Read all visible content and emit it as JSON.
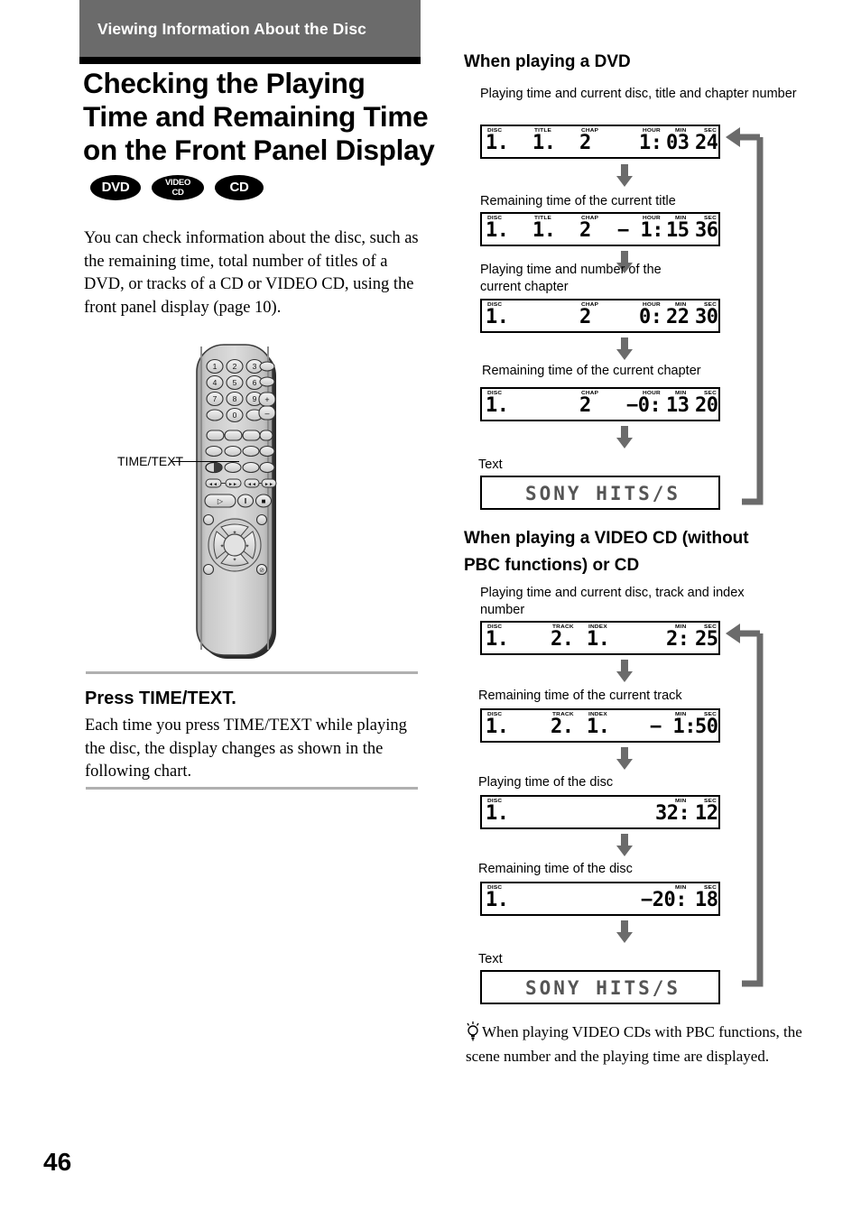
{
  "header": {
    "band_title": "Viewing Information About the Disc",
    "page_title": "Checking the Playing Time and Remaining Time on the Front Panel Display",
    "badges": [
      {
        "name": "dvd-badge",
        "label": "DVD"
      },
      {
        "name": "video-cd-badge",
        "line1": "VIDEO",
        "line2": "CD"
      },
      {
        "name": "cd-badge",
        "label": "CD"
      }
    ]
  },
  "intro": {
    "paragraph": "You can check information about the disc, such as the remaining time, total number of titles of a DVD, or tracks of a CD or VIDEO CD, using the front panel display (page 10)."
  },
  "remote": {
    "callout_label": "TIME/TEXT",
    "keypad": [
      "1",
      "2",
      "3",
      "4",
      "5",
      "6",
      "7",
      "8",
      "9",
      "0"
    ],
    "volume_plus": "+",
    "volume_minus": "−"
  },
  "press_section": {
    "heading": "Press TIME/TEXT.",
    "body": "Each time you press TIME/TEXT while playing the disc, the display changes as shown in the following chart."
  },
  "page_number": "46",
  "dvd_section": {
    "heading": "When playing a DVD",
    "steps": [
      {
        "caption": "Playing time and current disc, title and chapter number",
        "labels": [
          "DISC",
          "TITLE",
          "CHAP",
          "HOUR",
          "MIN",
          "SEC"
        ],
        "values": [
          "1.",
          "1.",
          "2",
          "1:",
          "03",
          "24"
        ]
      },
      {
        "caption": "Remaining time of the current title",
        "labels": [
          "DISC",
          "TITLE",
          "CHAP",
          "HOUR",
          "MIN",
          "SEC"
        ],
        "values": [
          "1.",
          "1.",
          "2",
          "− 1:",
          "15",
          "36"
        ]
      },
      {
        "caption": "Playing time and number of the current chapter",
        "labels": [
          "DISC",
          "CHAP",
          "HOUR",
          "MIN",
          "SEC"
        ],
        "values": [
          "1.",
          "2",
          "0:",
          "22",
          "30"
        ]
      },
      {
        "caption": "Remaining time of the current chapter",
        "labels": [
          "DISC",
          "CHAP",
          "HOUR",
          "MIN",
          "SEC"
        ],
        "values": [
          "1.",
          "2",
          "−0:",
          "13",
          "20"
        ]
      },
      {
        "caption": "Text",
        "labels": [],
        "text_value": "SONY HITS/S"
      }
    ]
  },
  "cd_section": {
    "heading": "When playing a VIDEO CD (without PBC functions) or CD",
    "steps": [
      {
        "caption": "Playing time and current disc, track and index number",
        "labels": [
          "DISC",
          "TRACK",
          "INDEX",
          "MIN",
          "SEC"
        ],
        "values": [
          "1.",
          "2.",
          "1.",
          "2:",
          "25"
        ]
      },
      {
        "caption": "Remaining time of the current track",
        "labels": [
          "DISC",
          "TRACK",
          "INDEX",
          "MIN",
          "SEC"
        ],
        "values": [
          "1.",
          "2.",
          "1.",
          "− 1:",
          "50"
        ]
      },
      {
        "caption": "Playing time of the disc",
        "labels": [
          "DISC",
          "MIN",
          "SEC"
        ],
        "values": [
          "1.",
          "32:",
          "12"
        ]
      },
      {
        "caption": "Remaining time of the disc",
        "labels": [
          "DISC",
          "MIN",
          "SEC"
        ],
        "values": [
          "1.",
          "−20:",
          "18"
        ]
      },
      {
        "caption": "Text",
        "labels": [],
        "text_value": "SONY HITS/S"
      }
    ]
  },
  "tip": {
    "icon": "lightbulb-icon",
    "text": "When playing VIDEO CDs with PBC functions, the scene number and the playing time are displayed."
  },
  "colors": {
    "band": "#6b6b6b",
    "rule": "#000000",
    "divider": "#b0b0b0",
    "arrow": "#666666"
  }
}
